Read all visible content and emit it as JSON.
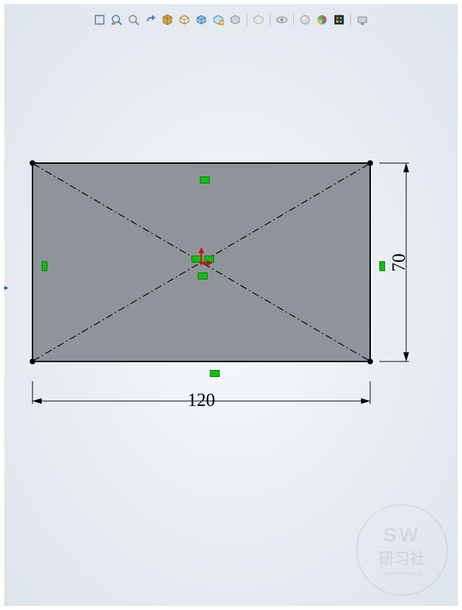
{
  "toolbar": {
    "icons": [
      "zoom-to-fit-icon",
      "zoom-area-icon",
      "zoom-icon",
      "previous-view-icon",
      "section-view-icon",
      "view-orientation-icon",
      "display-style-icon",
      "hide-show-icon",
      "edit-appearance-icon",
      "sep",
      "apply-scene-icon",
      "sep",
      "view-visibility-icon",
      "sep",
      "render-tools-icon",
      "appearances-icon",
      "settings-icon",
      "sep",
      "screen-capture-icon"
    ]
  },
  "sketch": {
    "dimensions": {
      "width": "120",
      "height": "70"
    },
    "relations": {
      "top_horizontal": "horizontal",
      "bottom_horizontal": "horizontal",
      "left_vertical": "vertical",
      "right_vertical": "vertical",
      "center_mid1": "midpoint",
      "center_mid2": "midpoint",
      "center_mid3": "midpoint"
    }
  },
  "watermark": {
    "abbr": "SW",
    "cn": "研习社",
    "en": "SolidWorks"
  },
  "colors": {
    "relation_green": "#0fbf0f",
    "face_gray": "#8f949a"
  }
}
